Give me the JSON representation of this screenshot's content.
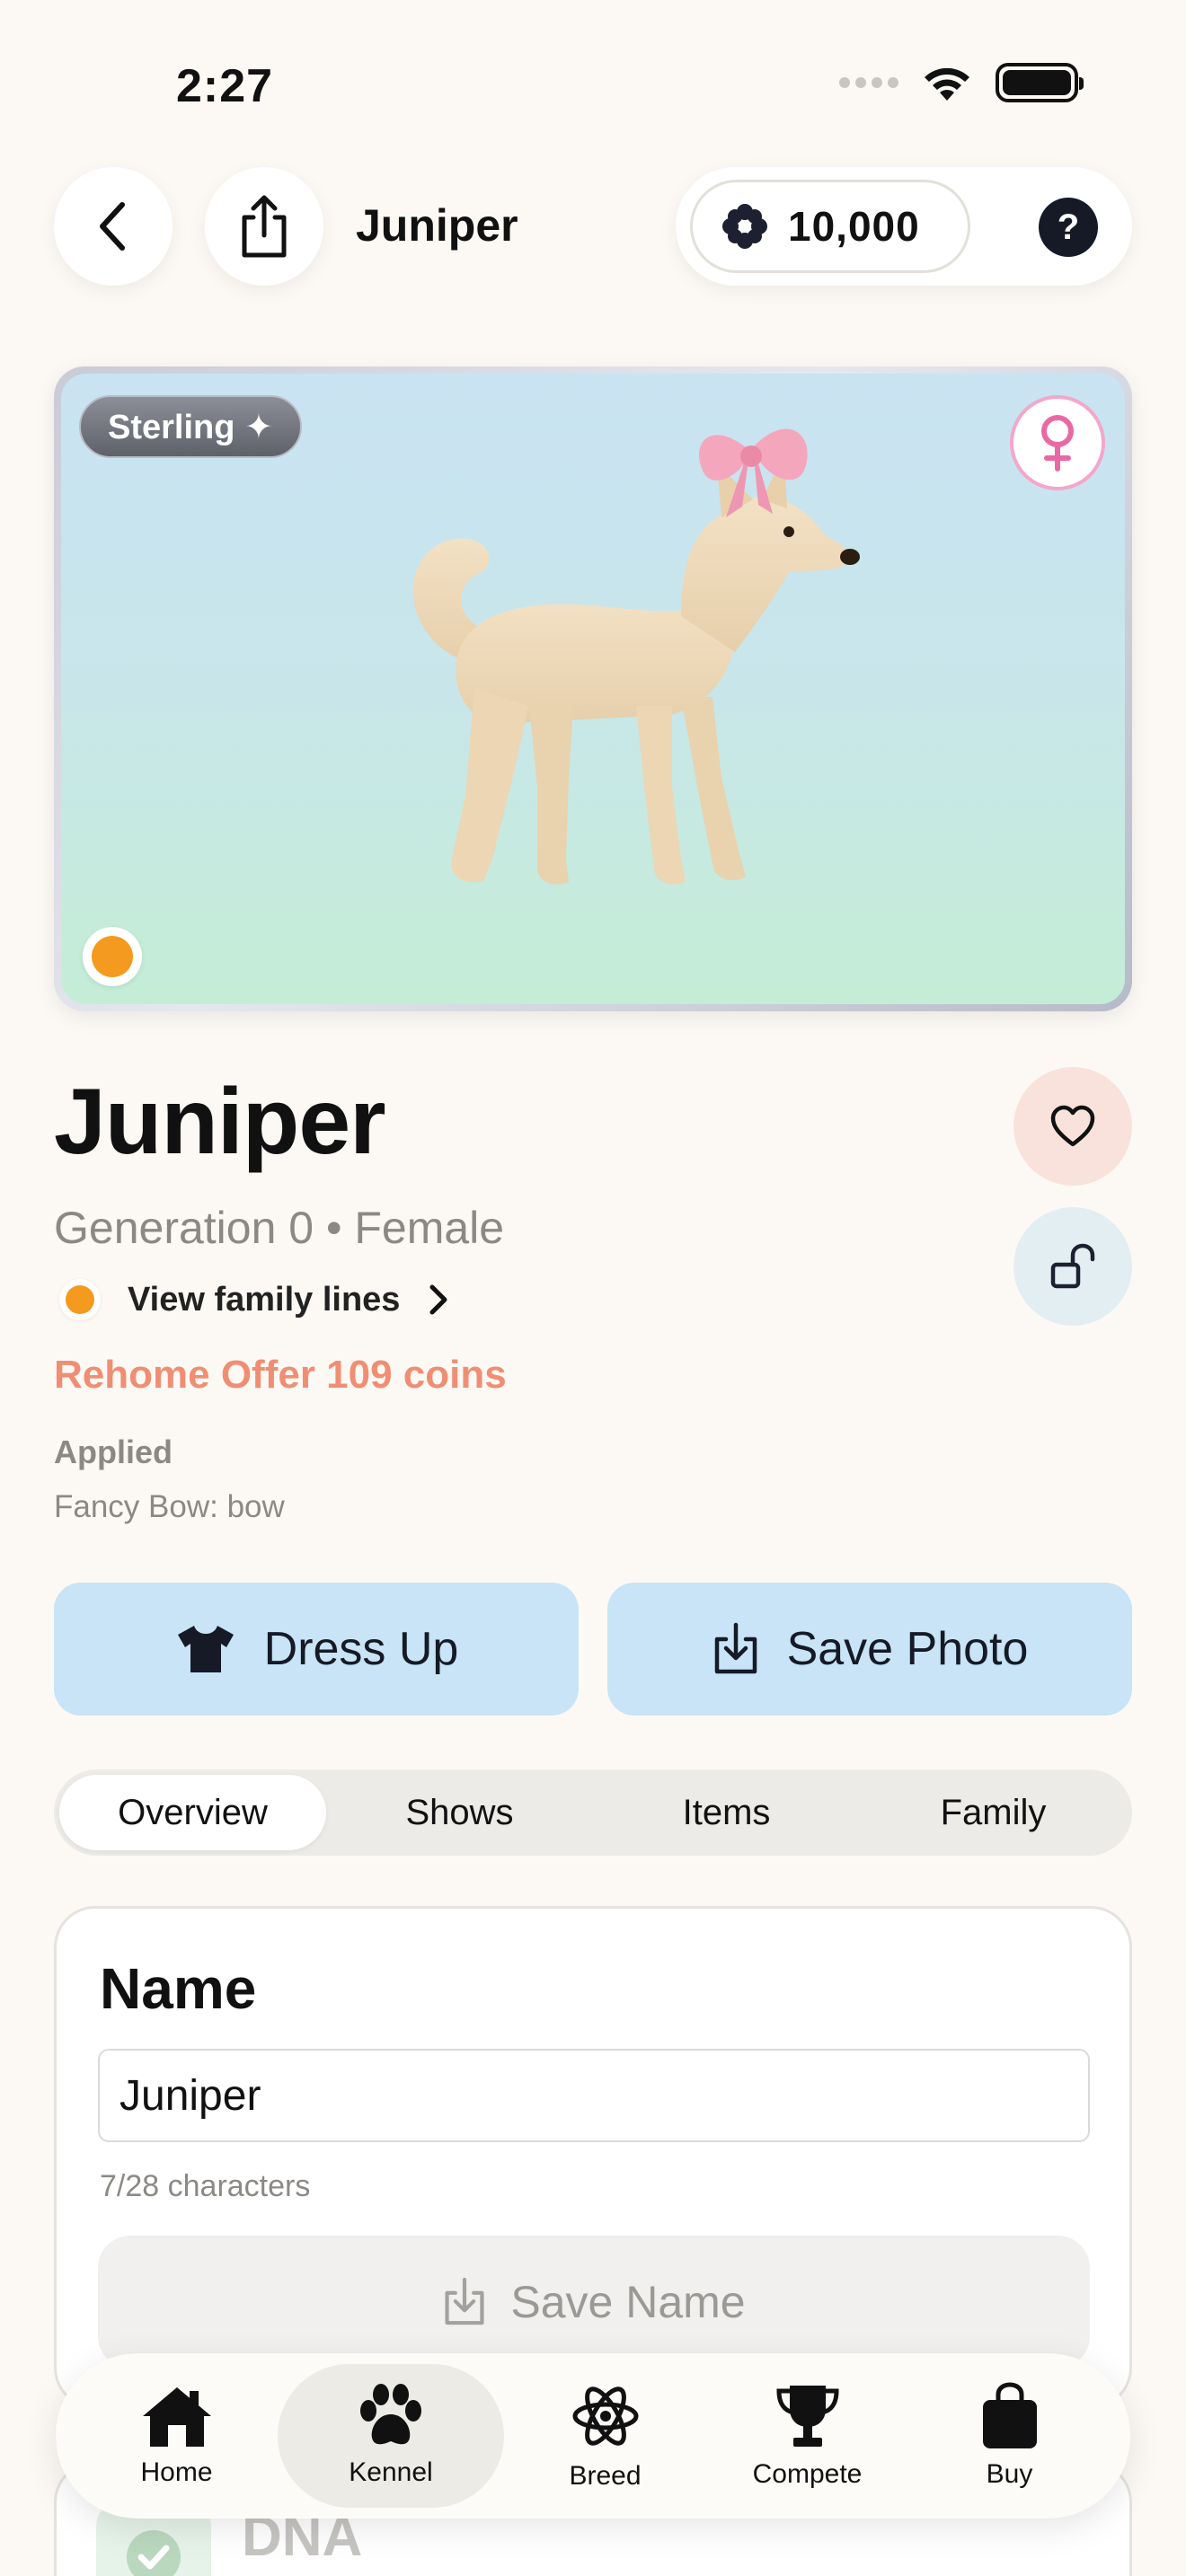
{
  "status_bar": {
    "time": "2:27"
  },
  "header": {
    "title": "Juniper",
    "coins": "10,000",
    "help": "?"
  },
  "hero": {
    "tier_badge": "Sterling ✦"
  },
  "pet": {
    "name": "Juniper",
    "generation": "Generation 0 • Female",
    "family_link": "View family lines",
    "rehome_offer": "Rehome Offer 109 coins",
    "applied_title": "Applied",
    "applied_item": "Fancy Bow: bow"
  },
  "actions": {
    "dress_up": "Dress Up",
    "save_photo": "Save Photo"
  },
  "tabs": [
    {
      "label": "Overview",
      "active": true
    },
    {
      "label": "Shows"
    },
    {
      "label": "Items"
    },
    {
      "label": "Family"
    }
  ],
  "name_card": {
    "title": "Name",
    "value": "Juniper",
    "char_count": "7/28 characters",
    "save_label": "Save Name"
  },
  "dna_card": {
    "title": "DNA"
  },
  "nav": [
    {
      "label": "Home",
      "icon": "home-icon"
    },
    {
      "label": "Kennel",
      "icon": "paw-icon",
      "active": true
    },
    {
      "label": "Breed",
      "icon": "atom-icon"
    },
    {
      "label": "Compete",
      "icon": "trophy-icon"
    },
    {
      "label": "Buy",
      "icon": "bag-icon"
    }
  ],
  "colors": {
    "background": "#fcf9f4",
    "accent_blue": "#c8e4f6",
    "rehome_orange": "#f08e74",
    "gender_pink": "#f3a7c9",
    "dot_orange": "#f49a1e"
  }
}
